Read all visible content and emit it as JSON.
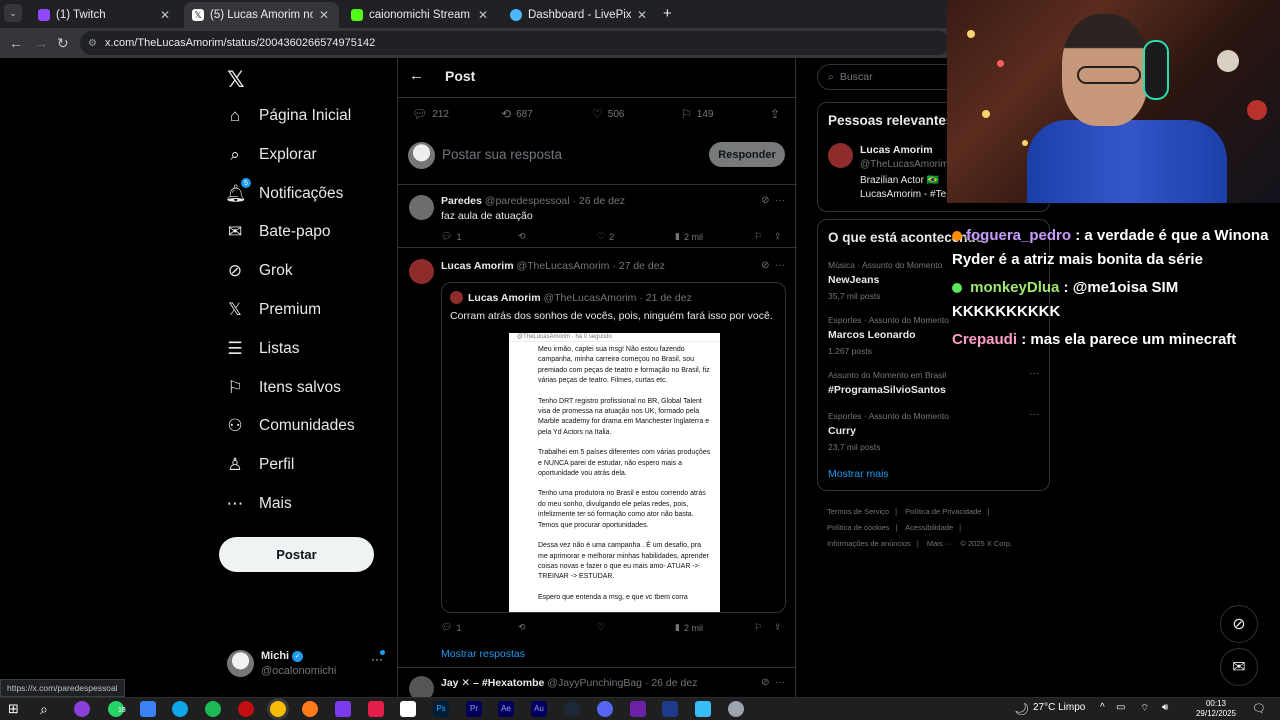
{
  "browser": {
    "tabs": [
      {
        "title": "(1) Twitch",
        "active": false,
        "favicon_color": "#9146ff"
      },
      {
        "title": "(5) Lucas Amorim no X: \"#Lucas...",
        "active": true,
        "favicon_color": "#ffffff"
      },
      {
        "title": "caionomichi Stream - Watch Li...",
        "active": false,
        "favicon_color": "#53fc18"
      },
      {
        "title": "Dashboard - LivePix",
        "active": false,
        "favicon_color": "#4db6ff"
      }
    ],
    "url": "x.com/TheLucasAmorim/status/2004360266574975142",
    "status_url": "https://x.com/paredespessoal"
  },
  "x": {
    "nav": [
      {
        "label": "Página Inicial",
        "icon": "home-icon",
        "bold": true
      },
      {
        "label": "Explorar",
        "icon": "search-icon"
      },
      {
        "label": "Notificações",
        "icon": "bell-icon",
        "badge": "5"
      },
      {
        "label": "Bate-papo",
        "icon": "mail-icon"
      },
      {
        "label": "Grok",
        "icon": "grok-icon"
      },
      {
        "label": "Premium",
        "icon": "x-logo-icon"
      },
      {
        "label": "Listas",
        "icon": "list-icon"
      },
      {
        "label": "Itens salvos",
        "icon": "bookmark-icon"
      },
      {
        "label": "Comunidades",
        "icon": "people-icon"
      },
      {
        "label": "Perfil",
        "icon": "person-icon"
      },
      {
        "label": "Mais",
        "icon": "more-circle-icon"
      }
    ],
    "post_button": "Postar",
    "account": {
      "name": "Michi",
      "handle": "@ocalonomichi"
    },
    "header_title": "Post",
    "stats": {
      "replies": "212",
      "reposts": "687",
      "likes": "506",
      "bookmarks": "149"
    },
    "reply_placeholder": "Postar sua resposta",
    "reply_button": "Responder",
    "tweets": [
      {
        "name": "Paredes",
        "handle": "@paredespessoal",
        "date": "· 26 de dez",
        "text": "faz aula de atuação",
        "replies": "1",
        "likes": "2",
        "views": "2 mil"
      },
      {
        "name": "Lucas Amorim",
        "handle": "@TheLucasAmorim",
        "date": "· 27 de dez",
        "replies": "1",
        "likes": "",
        "views": "2 mil",
        "quote": {
          "name": "Lucas Amorim",
          "handle": "@TheLucasAmorim",
          "date": "· 21 de dez",
          "text": "Corram atrás dos sonhos de vocês, pois, ninguém fará isso por você.",
          "image_header": "@TheLucasAmorim · há 0 segundo",
          "image_paragraphs": [
            "Meu irmão, captei sua msg! Não estou fazendo campanha, minha carreira começou no Brasil, sou premiado com peças de teatro e formação no Brasil, fiz várias peças de teatro. Filmes, curtas etc.",
            "Tenho DRT registro profissional no BR, Global Talent visa de promessa na atuação nos UK, formado pela Marble academy for drama em Manchester Inglaterra e pela Yd Actors na Italia.",
            "Trabalhei em 5 países diferentes com várias produções e NUNCA parei de estudar, não espero mais a oportunidade vou atrás dela.",
            "Tenho uma produtora no Brasil e estou correndo atrás do meu sonho, divulgando ele pelas redes, pois, infelizmente ter só formação como ator não basta. Temos que procurar oportunidades.",
            "Dessa vez não é uma campanha . É um desafio, pra me aprimorar e melhorar minhas habilidades, aprender coisas novas e fazer o que eu mais amo- ATUAR -> TREINAR -> ESTUDAR.",
            "Espero que entenda a msg, e que vc tbem corra"
          ]
        }
      },
      {
        "name": "Jay ✕ – #Hexatombe",
        "handle": "@JayyPunchingBag",
        "date": "· 26 de dez"
      }
    ],
    "show_replies": "Mostrar respostas",
    "search_placeholder": "Buscar",
    "relevant": {
      "title": "Pessoas relevantes",
      "name": "Lucas Amorim",
      "handle": "@TheLucasAmorim",
      "bio1": "Brazilian Actor 🇧🇷",
      "bio2": "LucasAmorim - #Te"
    },
    "trends_title": "O que está acontecendo",
    "trends": [
      {
        "context": "Música · Assunto do Momento",
        "name": "NewJeans",
        "posts": "35,7 mil posts"
      },
      {
        "context": "Esportes · Assunto do Momento",
        "name": "Marcos Leonardo",
        "posts": "1.267 posts"
      },
      {
        "context": "Assunto do Momento em Brasil",
        "name": "#ProgramaSilvioSantos",
        "posts": ""
      },
      {
        "context": "Esportes · Assunto do Momento",
        "name": "Curry",
        "posts": "23,7 mil posts"
      }
    ],
    "show_more": "Mostrar mais",
    "footer": [
      "Termos de Serviço",
      "|",
      "Política de Privacidade",
      "|",
      "Política de cookies",
      "|",
      "Acessibilidade",
      "|",
      "Informações de anúncios",
      "|",
      "Mais ···",
      "© 2025 X Corp."
    ]
  },
  "chat": [
    {
      "user": "foguera_pedro",
      "color": "#c89cff",
      "badge_color": "#ff8c00",
      "message": ": a verdade é que a Winona Ryder é a atriz mais bonita da série"
    },
    {
      "user": "monkeyDlua",
      "color": "#9fe870",
      "badge_color": "#5ce65c",
      "message": ": @me1oisa SIM KKKKKKKKKK"
    },
    {
      "user": "Crepaudi",
      "color": "#ff9ec8",
      "badge_color": "",
      "message": ": mas ela parece um minecraft"
    }
  ],
  "taskbar": {
    "weather": "27°C  Limpo",
    "time": "00:13",
    "date": "29/12/2025",
    "badge": "18"
  },
  "colors": {
    "accent": "#1d9bf0",
    "bg": "#000000",
    "border": "#2f3336",
    "muted": "#71767b"
  }
}
